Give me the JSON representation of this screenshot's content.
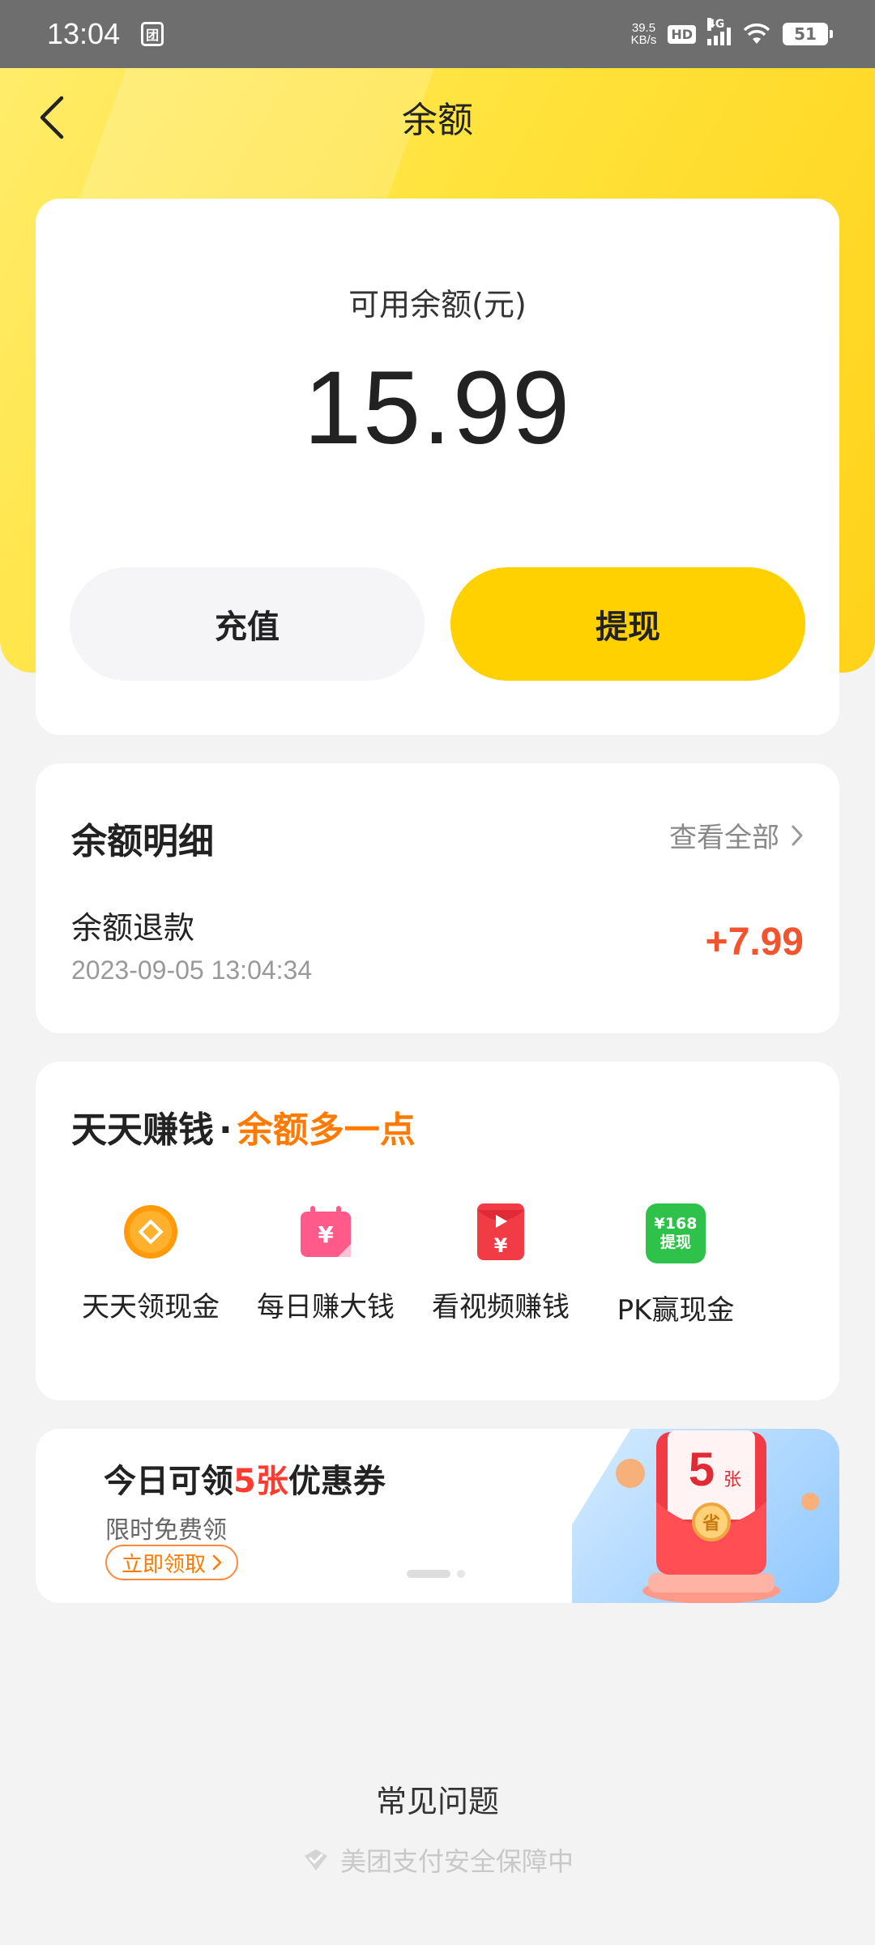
{
  "status_bar": {
    "time": "13:04",
    "app_icon_glyph": "团",
    "net_speed_value": "39.5",
    "net_speed_unit": "KB/s",
    "hd": "HD",
    "network": "4G",
    "battery": "51"
  },
  "nav": {
    "title": "余额",
    "back_icon": "chevron-left-icon"
  },
  "balance": {
    "label": "可用余额(元)",
    "amount": "15.99",
    "recharge_label": "充值",
    "withdraw_label": "提现"
  },
  "details": {
    "title": "余额明细",
    "view_all": "查看全部",
    "items": [
      {
        "name": "余额退款",
        "time": "2023-09-05 13:04:34",
        "amount": "+7.99"
      }
    ]
  },
  "earn": {
    "title_main": "天天赚钱",
    "title_sep": "·",
    "title_accent": "余额多一点",
    "items": [
      {
        "label": "天天领现金",
        "icon": "coin-icon"
      },
      {
        "label": "每日赚大钱",
        "icon": "calendar-yuan-icon"
      },
      {
        "label": "看视频赚钱",
        "icon": "video-redpacket-icon"
      },
      {
        "label": "PK赢现金",
        "icon": "withdraw-168-icon",
        "icon_text_top": "¥168",
        "icon_text_bottom": "提现"
      },
      {
        "label": "",
        "icon": "more-icon"
      }
    ]
  },
  "coupon": {
    "title_prefix": "今日可领",
    "title_number": "5张",
    "title_suffix": "优惠券",
    "subtitle": "限时免费领",
    "button": "立即领取",
    "art_count": "5",
    "art_unit": "张",
    "art_seal": "省"
  },
  "footer": {
    "faq": "常见问题",
    "secure": "美团支付安全保障中"
  },
  "colors": {
    "brand_yellow": "#ffd100",
    "amount_orange": "#f2542d",
    "accent_orange": "#ff7a00",
    "coupon_red": "#ff3b30"
  }
}
